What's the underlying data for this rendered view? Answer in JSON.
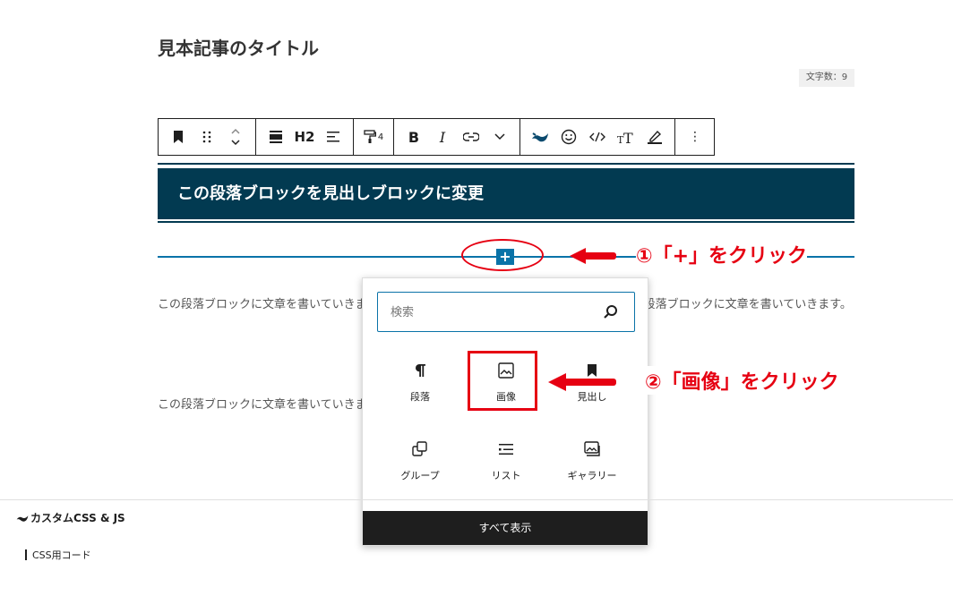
{
  "post": {
    "title": "見本記事のタイトル",
    "char_count": "文字数：9"
  },
  "toolbar": {
    "heading_level": "H2",
    "list_count": "4",
    "bold": "B",
    "italic": "I",
    "more": "⋮"
  },
  "heading_block": {
    "text": "この段落ブロックを見出しブロックに変更"
  },
  "paragraphs": [
    {
      "text": "この段落ブロックに文章を書いていきます。この段落ブロックに文章を書いていきます。この段落ブロックに文章を書いていきます。"
    },
    {
      "text": "この段落ブロックに文章を書いていきます。この段落ブロックに文章を書いていきます。"
    }
  ],
  "annotations": {
    "step1": "①「+」をクリック",
    "step2": "②「画像」をクリック"
  },
  "inserter": {
    "search_placeholder": "検索",
    "blocks": [
      {
        "label": "段落",
        "icon": "paragraph-icon"
      },
      {
        "label": "画像",
        "icon": "image-icon"
      },
      {
        "label": "見出し",
        "icon": "heading-bookmark-icon"
      },
      {
        "label": "グループ",
        "icon": "group-icon"
      },
      {
        "label": "リスト",
        "icon": "list-icon"
      },
      {
        "label": "ギャラリー",
        "icon": "gallery-icon"
      }
    ],
    "browse_all": "すべて表示"
  },
  "metabox": {
    "title": "カスタムCSS & JS",
    "sub": "CSS用コード"
  },
  "colors": {
    "heading_bg": "#023a51",
    "accent": "#0a73a8",
    "annotation": "#e60012"
  }
}
